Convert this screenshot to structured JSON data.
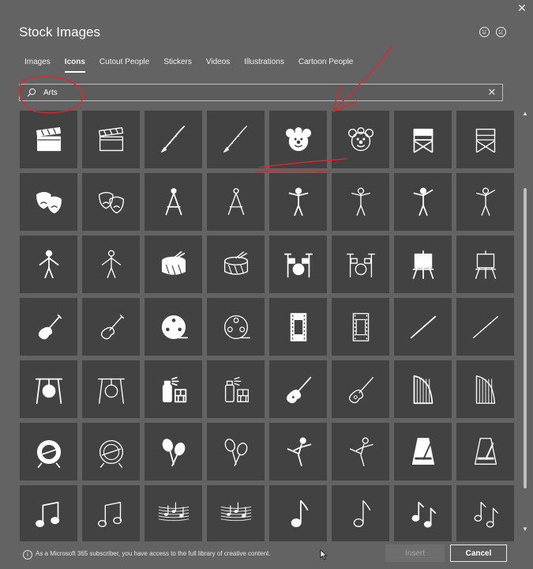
{
  "window": {
    "title": "Stock Images",
    "close_glyph": "✕"
  },
  "tabs": [
    {
      "label": "Images",
      "active": false
    },
    {
      "label": "Icons",
      "active": true
    },
    {
      "label": "Cutout People",
      "active": false
    },
    {
      "label": "Stickers",
      "active": false
    },
    {
      "label": "Videos",
      "active": false
    },
    {
      "label": "Illustrations",
      "active": false
    },
    {
      "label": "Cartoon People",
      "active": false
    }
  ],
  "search": {
    "value": "Arts",
    "icon": "search-icon",
    "clear_glyph": "✕"
  },
  "grid": {
    "tiles": [
      "clapperboard-filled",
      "clapperboard-outline",
      "clarinet-filled",
      "clarinet-outline",
      "clown-filled",
      "clown-outline",
      "directors-chair-filled",
      "directors-chair-outline",
      "theater-masks-filled",
      "theater-masks-outline",
      "compass-filled",
      "compass-outline",
      "mannequin-filled",
      "mannequin-outline",
      "mannequin-pose-filled",
      "mannequin-pose-outline",
      "mannequin-standing-filled",
      "mannequin-standing-outline",
      "drum-filled",
      "drum-outline",
      "drum-kit-filled",
      "drum-kit-outline",
      "easel-filled",
      "easel-outline",
      "electric-guitar-filled",
      "electric-guitar-outline",
      "film-reel-filled",
      "film-reel-outline",
      "film-strip-filled",
      "film-strip-outline",
      "flute-filled",
      "flute-outline",
      "gong-filled",
      "gong-outline",
      "graffiti-filled",
      "graffiti-outline",
      "guitar-filled",
      "guitar-outline",
      "harp-filled",
      "harp-outline",
      "bass-drum-filled",
      "bass-drum-outline",
      "maracas-filled",
      "maracas-outline",
      "martial-arts-filled",
      "martial-arts-outline",
      "metronome-filled",
      "metronome-outline",
      "music-note-beamed-filled",
      "music-note-beamed-outline",
      "music-staff-filled",
      "music-staff-outline",
      "music-note-filled",
      "music-note-outline",
      "music-notes-filled",
      "music-notes-outline"
    ]
  },
  "footer": {
    "info": "As a Microsoft 365 subscriber, you have access to the full library of creative content.",
    "info_glyph": "i",
    "insert_label": "Insert",
    "cancel_label": "Cancel"
  },
  "colors": {
    "background": "#636363",
    "tile": "#424242",
    "annotation": "#e0262e"
  }
}
